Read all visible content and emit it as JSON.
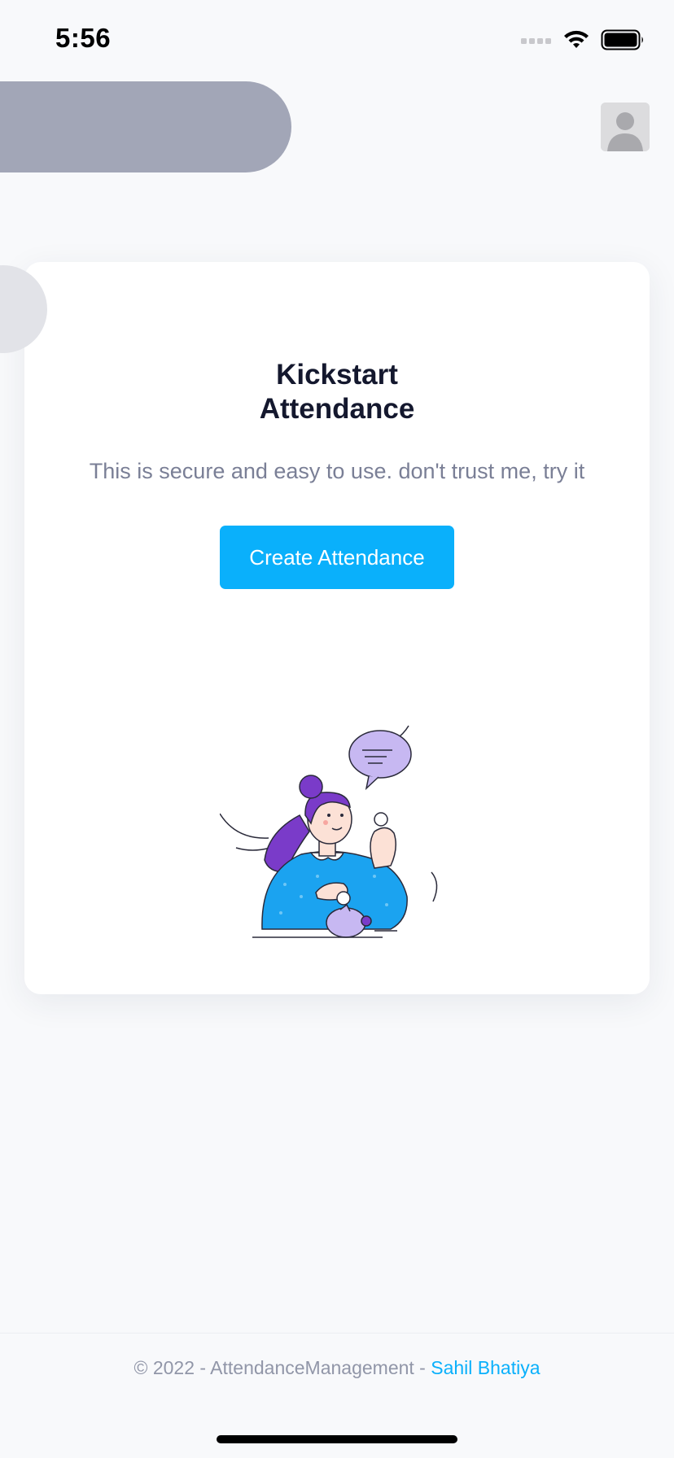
{
  "status_bar": {
    "time": "5:56",
    "icons": [
      "cellular-signal-icon",
      "wifi-icon",
      "battery-icon"
    ]
  },
  "header": {
    "avatar_icon": "user-avatar-icon"
  },
  "card": {
    "title_line1": "Kickstart",
    "title_line2": "Attendance",
    "subtitle": "This is secure and easy to use. don't trust me, try it",
    "button_label": "Create Attendance",
    "illustration_icon": "woman-with-coins-and-piggy-bank-illustration"
  },
  "footer": {
    "text": "© 2022 - AttendanceManagement - ",
    "author": "Sahil Bhatiya"
  },
  "colors": {
    "accent": "#0ab0fb",
    "title": "#14182e",
    "subtitle": "#7a7f96",
    "header_pill": "#a2a6b7",
    "background": "#f8f9fb"
  }
}
